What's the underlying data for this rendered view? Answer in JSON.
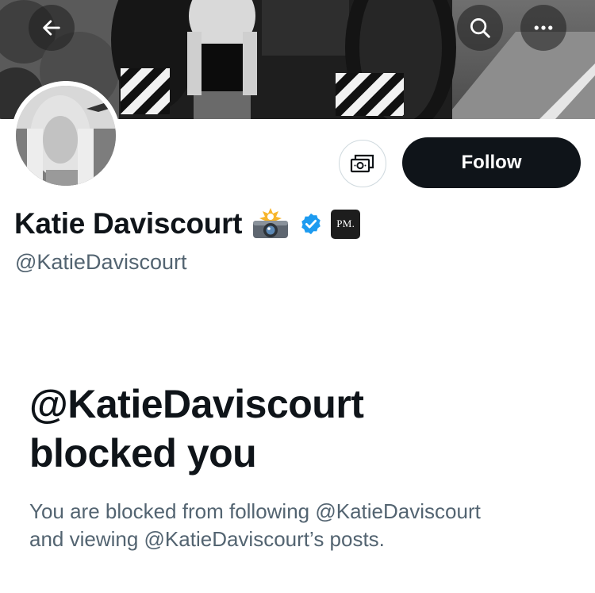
{
  "header": {
    "back_icon": "arrow-left-icon",
    "search_icon": "search-icon",
    "more_icon": "more-horizontal-icon"
  },
  "profile": {
    "display_name": "Katie Daviscourt",
    "name_emoji": "camera-with-flash-emoji",
    "verified_icon": "verified-badge-icon",
    "verified_color": "#1d9bf0",
    "affiliate_badge": "PM.",
    "handle": "@KatieDaviscourt"
  },
  "actions": {
    "subscribe_icon": "money-icon",
    "follow_label": "Follow"
  },
  "blocked": {
    "title_line1": "@KatieDaviscourt",
    "title_line2": "blocked you",
    "message_line1": "You are blocked from following @KatieDaviscourt",
    "message_line2": "and viewing @KatieDaviscourt’s posts."
  },
  "colors": {
    "primary_text": "#0f1419",
    "secondary_text": "#536471",
    "button_bg": "#0f1419",
    "border": "#cfd9de"
  }
}
